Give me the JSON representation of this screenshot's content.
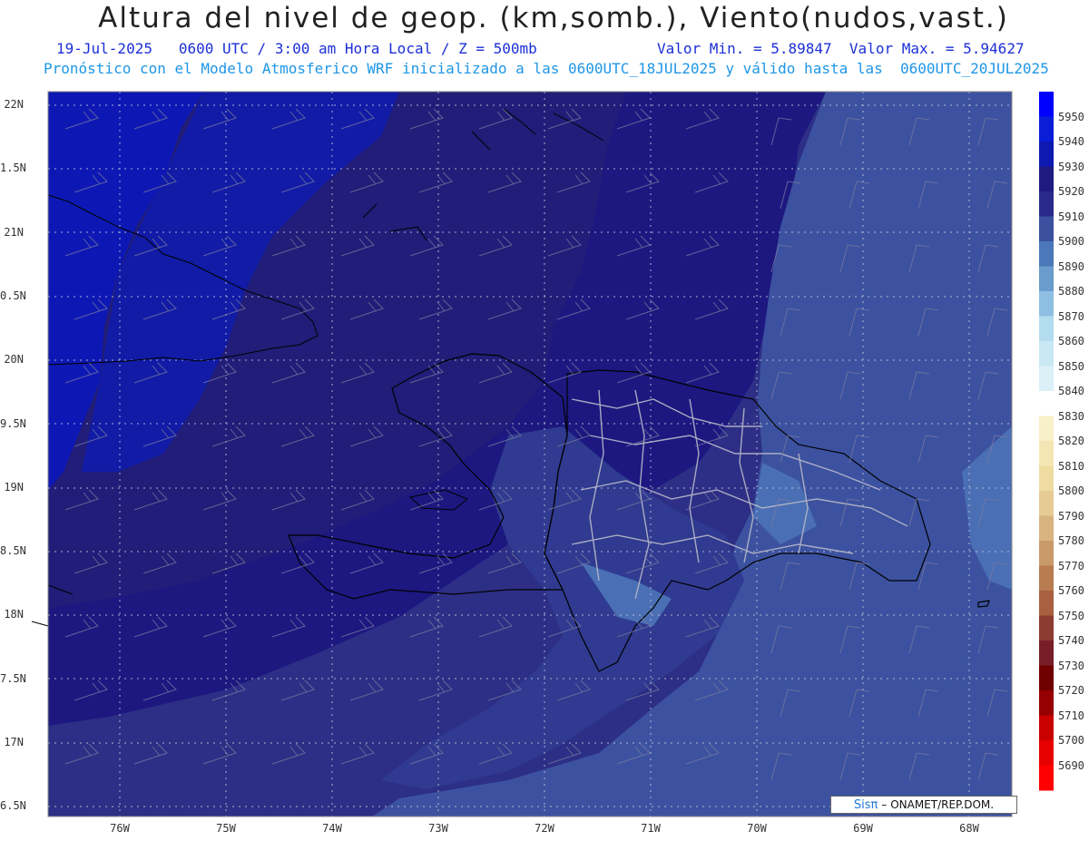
{
  "title": "Altura del nivel de geop. (km,somb.), Viento(nudos,vast.)",
  "subtitle_left": "19-Jul-2025   0600 UTC / 3:00 am Hora Local / Z = 500mb",
  "subtitle_right": "Valor Min. = 5.89847  Valor Max. = 5.94627",
  "model_line": "Pronóstico con el Modelo Atmosferico WRF inicializado a las 0600UTC_18JUL2025 y válido hasta las  0600UTC_20JUL2025",
  "credit": {
    "sis": "Sisπ",
    "text": "– ONAMET/REP.DOM."
  },
  "lat_labels": [
    "22N",
    "1.5N",
    "21N",
    "0.5N",
    "20N",
    "9.5N",
    "19N",
    "8.5N",
    "18N",
    "7.5N",
    "17N",
    "6.5N"
  ],
  "lon_labels": [
    "76W",
    "75W",
    "74W",
    "73W",
    "72W",
    "71W",
    "70W",
    "69W",
    "68W"
  ],
  "colorbar": {
    "levels": [
      5950,
      5940,
      5930,
      5920,
      5910,
      5900,
      5890,
      5880,
      5870,
      5860,
      5850,
      5840,
      5830,
      5820,
      5810,
      5800,
      5790,
      5780,
      5770,
      5760,
      5750,
      5740,
      5730,
      5720,
      5710,
      5700,
      5690
    ],
    "colors": [
      "#0000ff",
      "#0a1ed8",
      "#0d19b0",
      "#1e1a82",
      "#2a2a8c",
      "#3c50a0",
      "#4a78b8",
      "#6a9ccd",
      "#8ebfe2",
      "#b4dcf0",
      "#c8e8f4",
      "#dcf0f8",
      "#ffffff",
      "#f8f0c8",
      "#f4e6b4",
      "#eedca0",
      "#e6cc94",
      "#d8b480",
      "#c89a68",
      "#b87c50",
      "#a86040",
      "#8c3c30",
      "#781e28",
      "#700000",
      "#960000",
      "#c80000",
      "#e60000",
      "#ff0000"
    ]
  },
  "map_colors": {
    "v5940": "#0e1ec0",
    "v5930": "#18168a",
    "v5920": "#211d78",
    "v5910": "#2c2f85",
    "v5900": "#3c53a0",
    "v5890": "#4a78b8"
  }
}
